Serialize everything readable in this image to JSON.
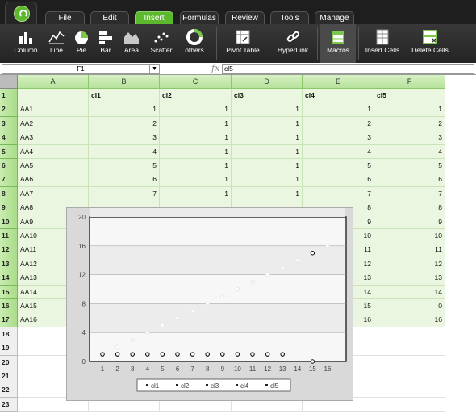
{
  "tabs": [
    {
      "label": "File",
      "active": false
    },
    {
      "label": "Edit",
      "active": false
    },
    {
      "label": "Insert",
      "active": true
    },
    {
      "label": "Formulas",
      "active": false
    },
    {
      "label": "Review",
      "active": false
    },
    {
      "label": "Tools",
      "active": false
    },
    {
      "label": "Manage",
      "active": false
    }
  ],
  "ribbon": {
    "column": "Column",
    "line": "Line",
    "pie": "Pie",
    "bar": "Bar",
    "area": "Area",
    "scatter": "Scatter",
    "others": "others",
    "pivot": "Pivot Table",
    "hyperlink": "HyperLink",
    "macros": "Macros",
    "insert_cells": "Insert Cells",
    "delete_cells": "Delete Cells"
  },
  "formula_bar": {
    "name_box": "F1",
    "formula": "cl5",
    "fx": "fx"
  },
  "columns": [
    "A",
    "B",
    "C",
    "D",
    "E",
    "F"
  ],
  "row_numbers": [
    "1",
    "2",
    "3",
    "4",
    "5",
    "6",
    "7",
    "8",
    "9",
    "10",
    "11",
    "12",
    "13",
    "14",
    "15",
    "16",
    "17",
    "18",
    "19",
    "20",
    "21",
    "22",
    "23"
  ],
  "sheet_header": [
    "",
    "cl1",
    "cl2",
    "cl3",
    "cl4",
    "cl5"
  ],
  "rows": [
    [
      "AA1",
      "1",
      "1",
      "1",
      "1",
      "1"
    ],
    [
      "AA2",
      "2",
      "1",
      "1",
      "2",
      "2"
    ],
    [
      "AA3",
      "3",
      "1",
      "1",
      "3",
      "3"
    ],
    [
      "AA4",
      "4",
      "1",
      "1",
      "4",
      "4"
    ],
    [
      "AA5",
      "5",
      "1",
      "1",
      "5",
      "5"
    ],
    [
      "AA6",
      "6",
      "1",
      "1",
      "6",
      "6"
    ],
    [
      "AA7",
      "7",
      "1",
      "1",
      "7",
      "7"
    ],
    [
      "AA8",
      "",
      "",
      "",
      "8",
      "8"
    ],
    [
      "AA9",
      "",
      "",
      "",
      "9",
      "9"
    ],
    [
      "AA10",
      "",
      "",
      "",
      "10",
      "10"
    ],
    [
      "AA11",
      "",
      "",
      "",
      "11",
      "11"
    ],
    [
      "AA12",
      "",
      "",
      "",
      "12",
      "12"
    ],
    [
      "AA13",
      "",
      "",
      "",
      "13",
      "13"
    ],
    [
      "AA14",
      "",
      "",
      "",
      "14",
      "14"
    ],
    [
      "AA15",
      "",
      "",
      "",
      "15",
      "0"
    ],
    [
      "AA16",
      "",
      "",
      "",
      "16",
      "16"
    ]
  ],
  "chart_data": {
    "type": "scatter",
    "x": [
      1,
      2,
      3,
      4,
      5,
      6,
      7,
      8,
      9,
      10,
      11,
      12,
      13,
      14,
      15,
      16
    ],
    "ylim": [
      0,
      20
    ],
    "yticks": [
      "0",
      "4",
      "8",
      "12",
      "16",
      "20"
    ],
    "xticks": [
      "1",
      "2",
      "3",
      "4",
      "5",
      "6",
      "7",
      "8",
      "9",
      "10",
      "11",
      "12",
      "13",
      "14",
      "15",
      "16"
    ],
    "series": [
      {
        "name": "cl1",
        "values": [
          1,
          2,
          3,
          4,
          5,
          6,
          7,
          8,
          9,
          10,
          11,
          12,
          13,
          14,
          15,
          16
        ],
        "color": "#e4e4e4"
      },
      {
        "name": "cl2",
        "values": [
          1,
          1,
          1,
          1,
          1,
          1,
          1,
          1,
          1,
          1,
          1,
          1,
          1,
          null,
          null,
          null
        ],
        "color": "#111111"
      },
      {
        "name": "cl3",
        "values": [
          1,
          1,
          1,
          1,
          1,
          1,
          1,
          1,
          1,
          1,
          1,
          1,
          1,
          null,
          null,
          null
        ],
        "color": "#111111"
      },
      {
        "name": "cl4",
        "values": [
          null,
          null,
          null,
          null,
          null,
          null,
          null,
          null,
          null,
          null,
          null,
          null,
          null,
          null,
          15,
          null
        ],
        "color": "#111111"
      },
      {
        "name": "cl5",
        "values": [
          null,
          null,
          null,
          null,
          null,
          null,
          null,
          null,
          null,
          null,
          null,
          null,
          null,
          null,
          0,
          null
        ],
        "color": "#111111"
      }
    ],
    "legend": [
      "cl1",
      "cl2",
      "cl3",
      "cl4",
      "cl5"
    ],
    "grid": true
  }
}
